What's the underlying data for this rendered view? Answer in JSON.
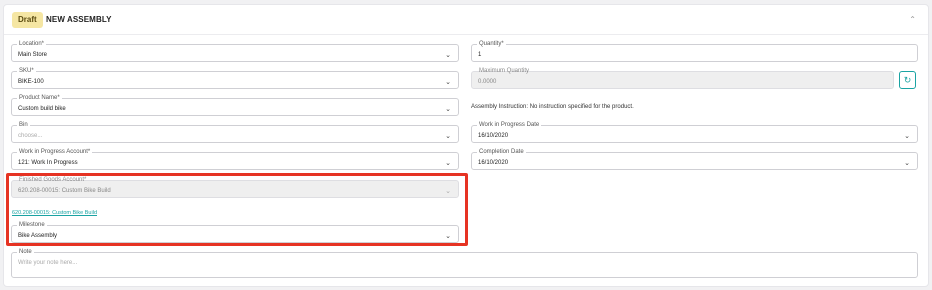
{
  "header": {
    "status_badge": "Draft",
    "title": "NEW ASSEMBLY",
    "collapse_icon": "chevron-up-icon"
  },
  "form": {
    "location": {
      "label": "Location*",
      "value": "Main Store"
    },
    "sku": {
      "label": "SKU*",
      "value": "BIKE-100"
    },
    "product_name": {
      "label": "Product Name*",
      "value": "Custom build bike"
    },
    "bin": {
      "label": "Bin",
      "placeholder": "choose..."
    },
    "wip_account": {
      "label": "Work in Progress Account*",
      "value": "121: Work In Progress"
    },
    "finished_goods_account": {
      "label": "Finished Goods Account*",
      "value": "620.208-00015: Custom Bike Build"
    },
    "finished_goods_link": "620.208-00015: Custom Bike Build",
    "milestone": {
      "label": "Milestone",
      "value": "Bike Assembly"
    },
    "note": {
      "label": "Note",
      "placeholder": "Write your note here..."
    },
    "quantity": {
      "label": "Quantity*",
      "value": "1"
    },
    "max_quantity": {
      "label": "Maximum Quantity",
      "value": "0.0000"
    },
    "assembly_instruction": "Assembly Instruction: No instruction specified for the product.",
    "wip_date": {
      "label": "Work in Progress Date",
      "value": "16/10/2020"
    },
    "completion_date": {
      "label": "Completion Date",
      "value": "16/10/2020"
    }
  },
  "icons": {
    "dropdown": "chevron-down-icon",
    "refresh": "refresh-icon"
  },
  "colors": {
    "draft_badge": "#f5e6a3",
    "accent": "#1aa3a3",
    "highlight_box": "#e63323"
  }
}
